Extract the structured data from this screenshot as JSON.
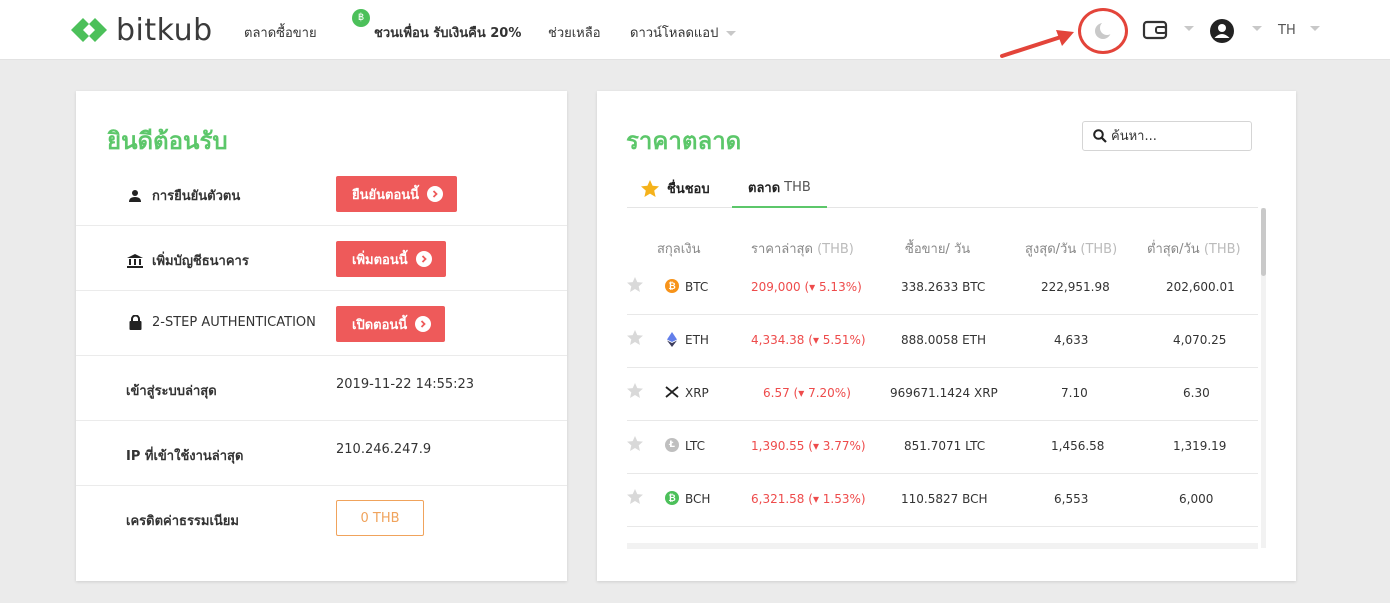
{
  "nav": {
    "brand": "bitkub",
    "items": {
      "market": "ตลาดซื้อขาย",
      "referral": "ชวนเพื่อน รับเงินคืน 20%",
      "help": "ช่วยเหลือ",
      "download": "ดาวน์โหลดแอป"
    },
    "language": "TH"
  },
  "welcome": {
    "title": "ยินดีต้อนรับ",
    "identity": {
      "label": "การยืนยันตัวตน",
      "button": "ยืนยันตอนนี้"
    },
    "bank": {
      "label": "เพิ่มบัญชีธนาคาร",
      "button": "เพิ่มตอนนี้"
    },
    "twofa": {
      "label": "2-STEP AUTHENTICATION",
      "button": "เปิดตอนนี้"
    },
    "last_login": {
      "label": "เข้าสู่ระบบล่าสุด",
      "value": "2019-11-22 14:55:23"
    },
    "last_ip": {
      "label": "IP ที่เข้าใช้งานล่าสุด",
      "value": "210.246.247.9"
    },
    "fee_credit": {
      "label": "เครดิตค่าธรรมเนียม",
      "value": "0 THB"
    }
  },
  "market": {
    "title": "ราคาตลาด",
    "search_placeholder": "ค้นหา...",
    "tabs": {
      "favorites": "ชื่นชอบ",
      "market": "ตลาด",
      "market_suffix": "THB"
    },
    "headers": {
      "currency": "สกุลเงิน",
      "last_price": "ราคาล่าสุด",
      "last_price_unit": "(THB)",
      "volume": "ซื้อขาย/ วัน",
      "high": "สูงสุด/วัน",
      "high_unit": "(THB)",
      "low": "ต่ำสุด/วัน",
      "low_unit": "(THB)"
    },
    "rows": [
      {
        "symbol": "BTC",
        "price": "209,000",
        "change": "5.13%",
        "volume": "338.2633 BTC",
        "high": "222,951.98",
        "low": "202,600.01"
      },
      {
        "symbol": "ETH",
        "price": "4,334.38",
        "change": "5.51%",
        "volume": "888.0058 ETH",
        "high": "4,633",
        "low": "4,070.25"
      },
      {
        "symbol": "XRP",
        "price": "6.57",
        "change": "7.20%",
        "volume": "969671.1424 XRP",
        "high": "7.10",
        "low": "6.30"
      },
      {
        "symbol": "LTC",
        "price": "1,390.55",
        "change": "3.77%",
        "volume": "851.7071 LTC",
        "high": "1,456.58",
        "low": "1,319.19"
      },
      {
        "symbol": "BCH",
        "price": "6,321.58",
        "change": "1.53%",
        "volume": "110.5827 BCH",
        "high": "6,553",
        "low": "6,000"
      }
    ]
  },
  "colors": {
    "brand_green": "#5cc76a",
    "alert_red": "#ee5a5a",
    "price_down": "#ee4b4b",
    "credit_orange": "#f0a35c",
    "annotation_red": "#e3443a"
  }
}
